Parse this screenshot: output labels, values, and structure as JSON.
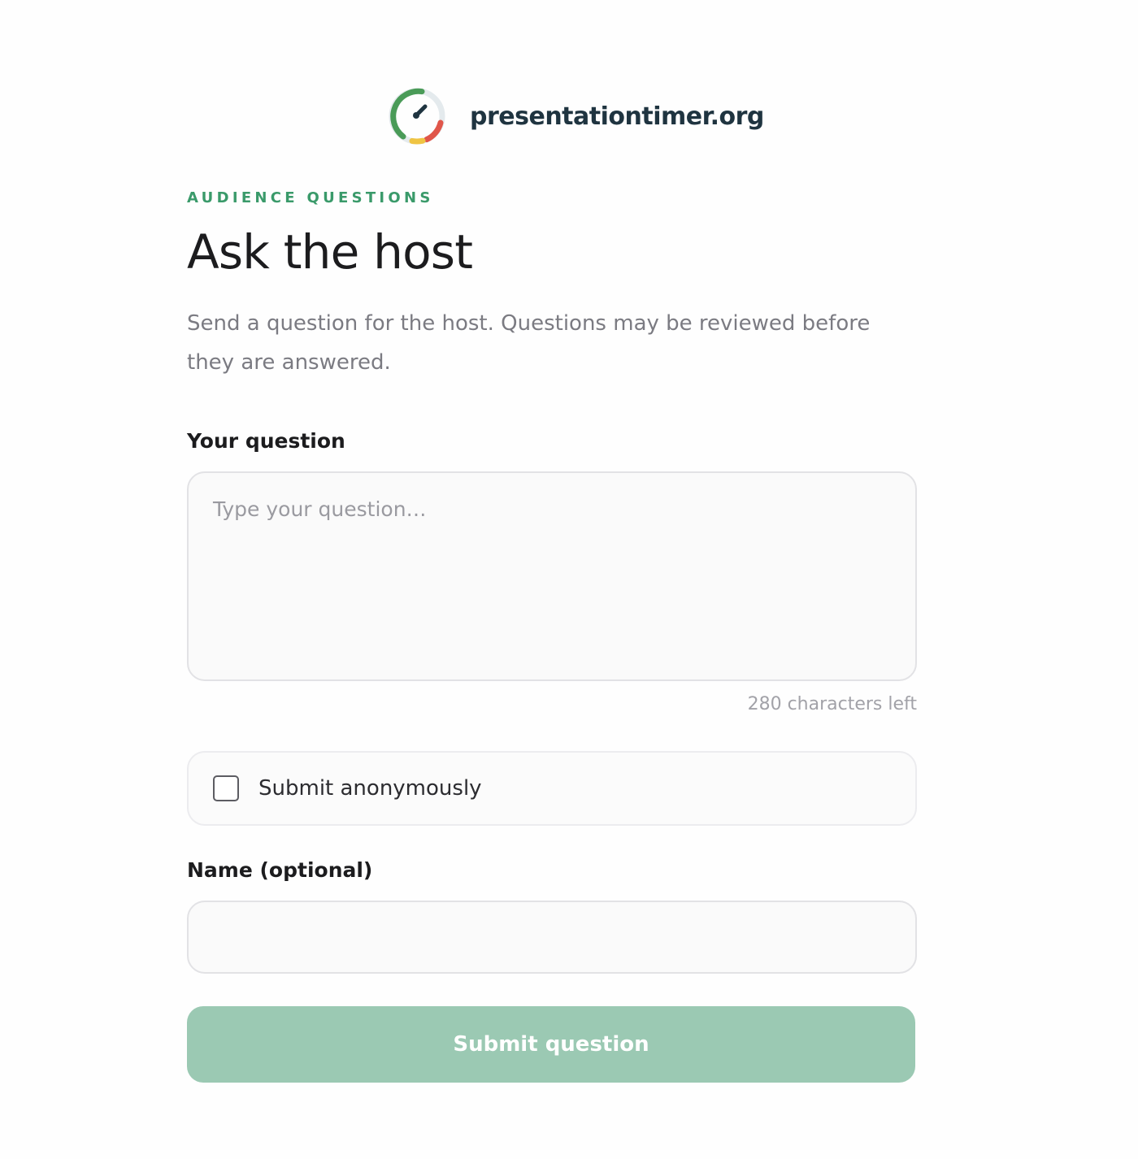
{
  "brand": {
    "name": "presentationtimer.org",
    "logo_icon": "timer-gauge-icon",
    "logo_colors": {
      "green": "#4a9b58",
      "red": "#e0564a",
      "yellow": "#efc443",
      "track": "#e4eaed",
      "needle": "#1f3440"
    }
  },
  "header": {
    "eyebrow": "AUDIENCE QUESTIONS",
    "title": "Ask the host",
    "description": "Send a question for the host. Questions may be reviewed before they are answered."
  },
  "form": {
    "question": {
      "label": "Your question",
      "placeholder": "Type your question…",
      "value": "",
      "chars_left_text": "280 characters left"
    },
    "anonymous": {
      "label": "Submit anonymously",
      "checked": false
    },
    "name": {
      "label": "Name (optional)",
      "value": ""
    },
    "submit_label": "Submit question"
  },
  "colors": {
    "accent": "#3a9a6a",
    "submit_disabled": "#9bc9b3"
  }
}
